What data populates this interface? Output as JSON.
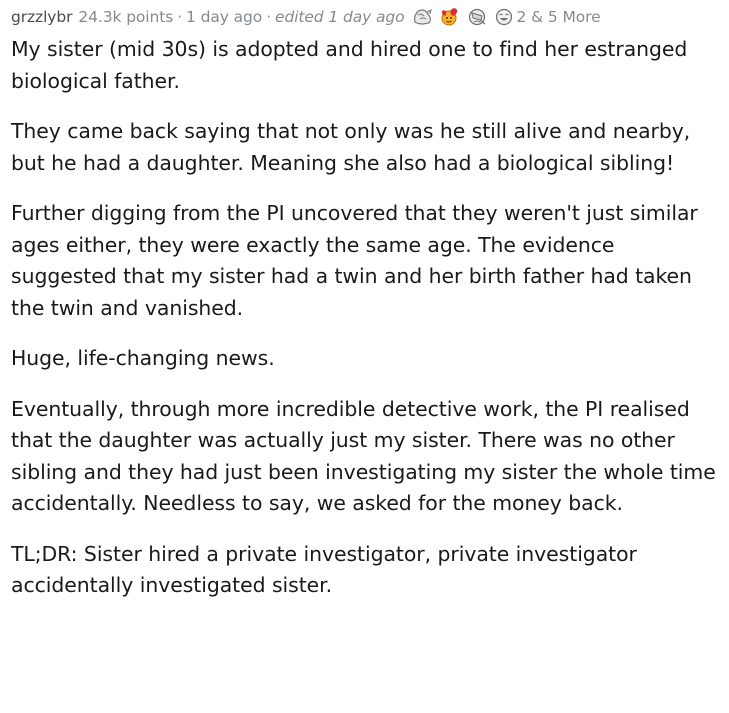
{
  "comment": {
    "author": "grzzlybr",
    "points": "24.3k points",
    "separator": "·",
    "time": "1 day ago",
    "edited": "edited 1 day ago",
    "awards": [
      {
        "icon": "silver-award-icon"
      },
      {
        "icon": "wholesome-award-icon"
      },
      {
        "icon": "facepalm-award-icon"
      },
      {
        "icon": "laughing-award-icon"
      }
    ],
    "award_count": "2 & 5 More",
    "paragraphs": [
      "My sister (mid 30s) is adopted and hired one to find her estranged biological father.",
      "They came back saying that not only was he still alive and nearby, but he had a daughter. Meaning she also had a biological sibling!",
      "Further digging from the PI uncovered that they weren't just similar ages either, they were exactly the same age. The evidence suggested that my sister had a twin and her birth father had taken the twin and vanished.",
      "Huge, life-changing news.",
      "Eventually, through more incredible detective work, the PI realised that the daughter was actually just my sister. There was no other sibling and they had just been investigating my sister the whole time accidentally. Needless to say, we asked for the money back.",
      "TL;DR: Sister hired a private investigator, private investigator accidentally investigated sister."
    ]
  }
}
